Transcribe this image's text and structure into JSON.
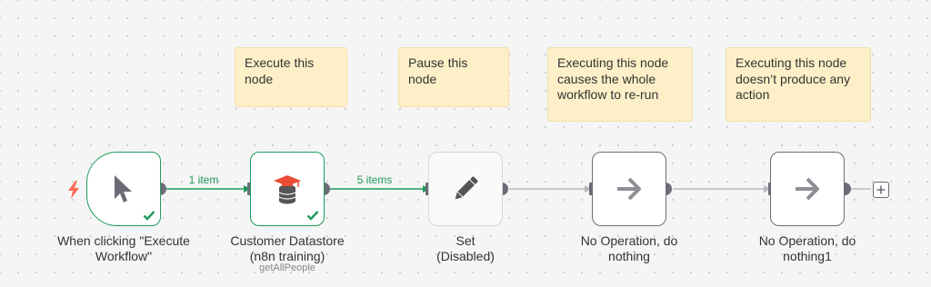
{
  "sticky_notes": [
    {
      "text": "Execute this node"
    },
    {
      "text": "Pause this node"
    },
    {
      "text": "Executing this node causes the whole workflow to re-run"
    },
    {
      "text": "Executing this node doesn’t produce any action"
    }
  ],
  "nodes": [
    {
      "title_line1": "When clicking \"Execute",
      "title_line2": "Workflow\"",
      "icon": "cursor-icon",
      "status": "success"
    },
    {
      "title_line1": "Customer Datastore",
      "title_line2": "(n8n training)",
      "subtitle": "getAllPeople",
      "icon": "datastore-icon",
      "status": "success"
    },
    {
      "title_line1": "Set",
      "title_line2": "(Disabled)",
      "icon": "pencil-icon",
      "status": "disabled"
    },
    {
      "title_line1": "No Operation, do",
      "title_line2": "nothing",
      "icon": "arrow-right-icon",
      "status": "idle"
    },
    {
      "title_line1": "No Operation, do",
      "title_line2": "nothing1",
      "icon": "arrow-right-icon",
      "status": "idle"
    }
  ],
  "connections": [
    {
      "label": "1 item"
    },
    {
      "label": "5 items"
    },
    {
      "label": ""
    },
    {
      "label": ""
    }
  ],
  "colors": {
    "success": "#1f9a5b",
    "node_border": "#6c6c78",
    "sticky_bg": "#fdf0c8",
    "trigger_bolt": "#ff6d5a"
  }
}
